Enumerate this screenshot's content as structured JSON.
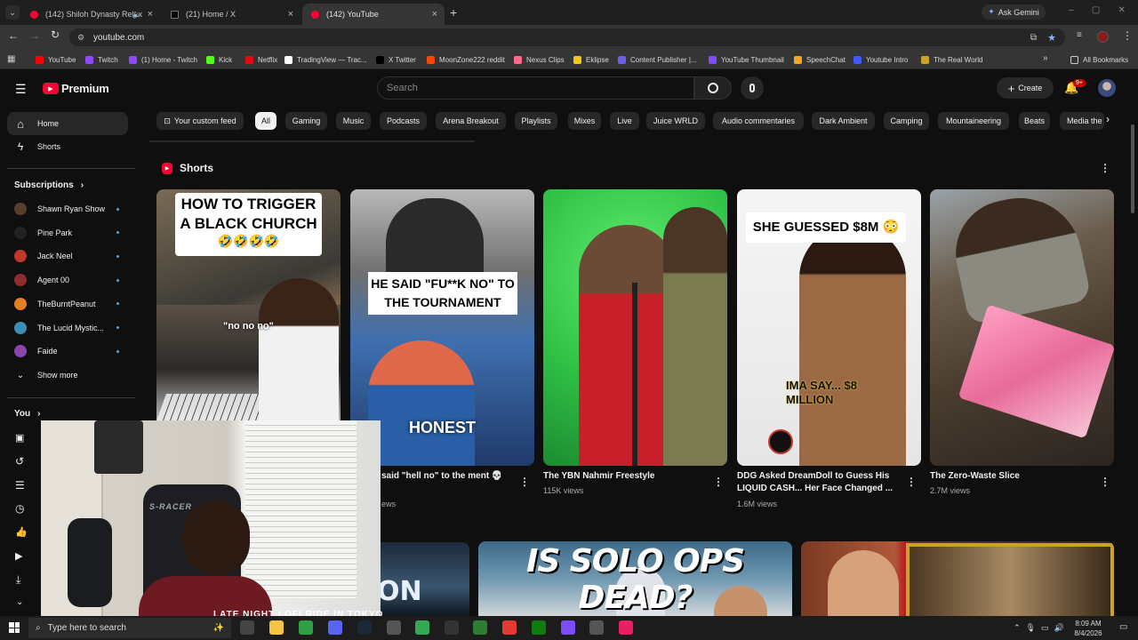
{
  "tabs": [
    {
      "title": "(142) Shiloh Dynasty Relax"
    },
    {
      "title": "(21) Home / X"
    },
    {
      "title": "(142) YouTube"
    }
  ],
  "new_tab_label": "+",
  "ask_gemini": "Ask Gemini",
  "omnibox": {
    "url": "youtube.com"
  },
  "bookmarks": [
    {
      "label": "YouTube",
      "color": "#ff0000"
    },
    {
      "label": "Twitch",
      "color": "#9146ff"
    },
    {
      "label": "(1) Home - Twitch",
      "color": "#9146ff"
    },
    {
      "label": "Kick",
      "color": "#53fc18"
    },
    {
      "label": "Netflix",
      "color": "#e50914"
    },
    {
      "label": "TradingView — Trac...",
      "color": "#ffffff"
    },
    {
      "label": "X Twitter",
      "color": "#000000"
    },
    {
      "label": "MoonZone222 reddit",
      "color": "#ff4500"
    },
    {
      "label": "Nexus Clips",
      "color": "#ff6a88"
    },
    {
      "label": "Eklipse",
      "color": "#f5c518"
    },
    {
      "label": "Content Publisher |...",
      "color": "#6c5ce7"
    },
    {
      "label": "YouTube Thumbnail",
      "color": "#7c4dff"
    },
    {
      "label": "SpeechChat",
      "color": "#f5a623"
    },
    {
      "label": "Youtube Intro",
      "color": "#3d5afe"
    },
    {
      "label": "The Real World",
      "color": "#c9a227"
    }
  ],
  "all_bookmarks": "All Bookmarks",
  "logo_text": "Premium",
  "search_placeholder": "Search",
  "create_label": "Create",
  "notif_badge": "9+",
  "chips": [
    "Your custom feed",
    "All",
    "Gaming",
    "Music",
    "Podcasts",
    "Arena Breakout",
    "Playlists",
    "Mixes",
    "Live",
    "Juice WRLD",
    "Audio commentaries",
    "Dark Ambient",
    "Camping",
    "Mountaineering",
    "Beats",
    "Media the"
  ],
  "sidebar": {
    "home": "Home",
    "shorts": "Shorts",
    "subscriptions_heading": "Subscriptions",
    "subscriptions": [
      {
        "name": "Shawn Ryan Show",
        "color": "#5a3e2b"
      },
      {
        "name": "Pine Park",
        "color": "#222222"
      },
      {
        "name": "Jack Neel",
        "color": "#c0392b"
      },
      {
        "name": "Agent 00",
        "color": "#8e2b2b"
      },
      {
        "name": "TheBurntPeanut",
        "color": "#e67e22"
      },
      {
        "name": "The Lucid Mystic...",
        "color": "#3a8fb7"
      },
      {
        "name": "Faide",
        "color": "#8e44ad"
      }
    ],
    "show_more": "Show more",
    "you_heading": "You"
  },
  "shorts_section": {
    "heading": "Shorts",
    "items": [
      {
        "overlay": "HOW TO TRIGGER A BLACK CHURCH",
        "emoji": "🤣🤣🤣🤣",
        "caption": "\"no no no\"",
        "title": "",
        "views": ""
      },
      {
        "overlay": "HE SAID \"FU**K NO\" TO THE TOURNAMENT",
        "caption": "HONEST",
        "title": "said \"hell no\" to the ment 💀",
        "views": "ews"
      },
      {
        "title": "The YBN Nahmir Freestyle",
        "views": "115K views"
      },
      {
        "overlay": "SHE GUESSED $8M 😳",
        "caption": "IMA SAY... $8 MILLION",
        "title": "DDG Asked DreamDoll to Guess His LIQUID CASH... Her Face Changed ...",
        "views": "1.6M views"
      },
      {
        "title": "The Zero-Waste Slice",
        "views": "2.7M views"
      }
    ]
  },
  "bottom_thumbs": {
    "solo": "IS SOLO OPS DEAD?",
    "lofi_partial": "ON",
    "lofi_sub": "LATE NIGHT LOFI RIDE IN TOKYO"
  },
  "webcam": {
    "chair_text": "S-RACER"
  },
  "taskbar": {
    "search_placeholder": "Type here to search",
    "time": "8:09 AM",
    "date": "8/4/2026"
  }
}
